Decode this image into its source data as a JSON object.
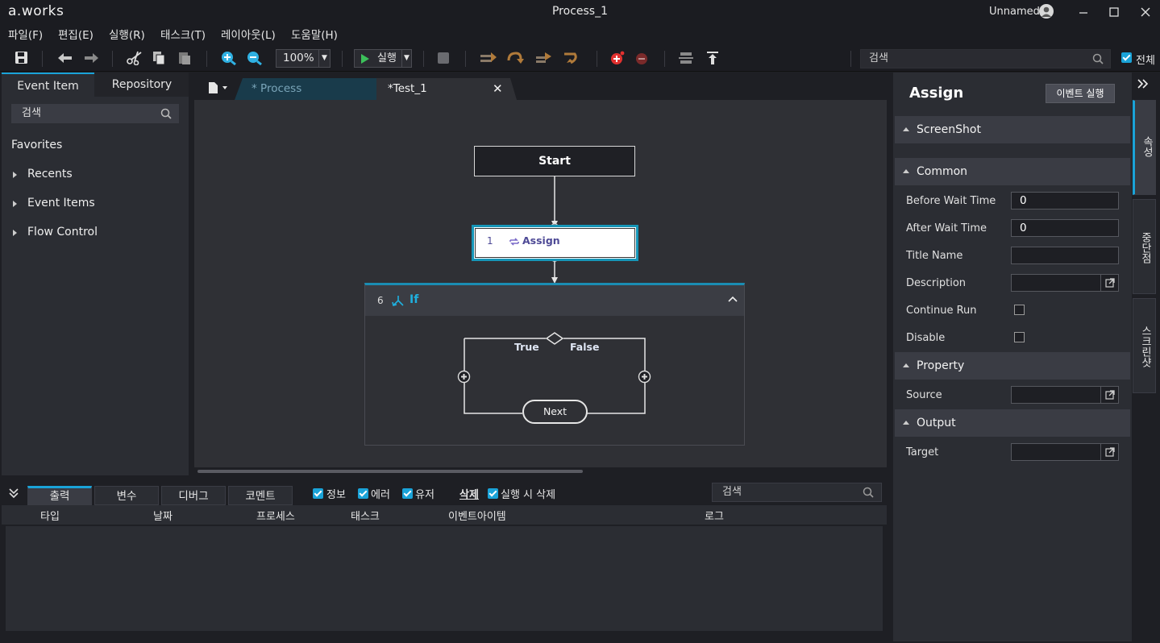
{
  "app": {
    "logo": "a.works",
    "window_title": "Process_1",
    "user": "Unnamed"
  },
  "menu": [
    "파일(F)",
    "편집(E)",
    "실행(R)",
    "태스크(T)",
    "레이아웃(L)",
    "도움말(H)"
  ],
  "toolbar": {
    "zoom": "100%",
    "run_label": "실행",
    "search_placeholder": "검색",
    "all_label": "전체"
  },
  "left_panel": {
    "tabs": [
      "Event Item",
      "Repository"
    ],
    "search_placeholder": "검색",
    "favorites": "Favorites",
    "tree": [
      "Recents",
      "Event Items",
      "Flow Control"
    ]
  },
  "doc_tabs": {
    "tab1": "* Process",
    "tab2": "*Test_1"
  },
  "flow": {
    "start": "Start",
    "assign_num": "1",
    "assign_label": "Assign",
    "if_num": "6",
    "if_label": "If",
    "true_label": "True",
    "false_label": "False",
    "next_label": "Next"
  },
  "bottom": {
    "tabs": [
      "출력",
      "변수",
      "디버그",
      "코멘트"
    ],
    "filters": [
      "정보",
      "에러",
      "유저"
    ],
    "delete": "삭제",
    "delete_on_run": "실행 시 삭제",
    "search_placeholder": "검색",
    "columns": [
      "타입",
      "날짜",
      "프로세스",
      "태스크",
      "이벤트아이템",
      "로그"
    ]
  },
  "right_panel": {
    "title": "Assign",
    "run_event": "이벤트 실행",
    "sections": [
      "ScreenShot",
      "Common",
      "Property",
      "Output"
    ],
    "common": {
      "before_wait_label": "Before Wait Time",
      "before_wait_value": "0",
      "after_wait_label": "After Wait Time",
      "after_wait_value": "0",
      "title_name_label": "Title Name",
      "description_label": "Description",
      "continue_run_label": "Continue Run",
      "disable_label": "Disable"
    },
    "property": {
      "source_label": "Source"
    },
    "output": {
      "target_label": "Target"
    },
    "side_tabs": [
      "속성",
      "중단점",
      "스크린샷"
    ]
  }
}
